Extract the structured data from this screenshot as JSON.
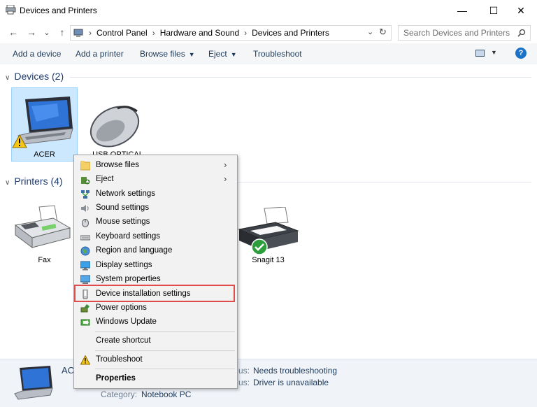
{
  "window": {
    "title": "Devices and Printers",
    "controls": {
      "minimize": "—",
      "maximize": "☐",
      "close": "✕"
    }
  },
  "nav": {
    "back": "←",
    "forward": "→",
    "recent": "⌄",
    "up": "↑",
    "breadcrumb": [
      "Control Panel",
      "Hardware and Sound",
      "Devices and Printers"
    ],
    "search_placeholder": "Search Devices and Printers"
  },
  "toolbar": {
    "add_device": "Add a device",
    "add_printer": "Add a printer",
    "browse_files": "Browse files",
    "eject": "Eject",
    "troubleshoot": "Troubleshoot",
    "help": "?"
  },
  "groups": {
    "devices": {
      "label": "Devices (2)"
    },
    "printers": {
      "label": "Printers (4)"
    }
  },
  "devices": [
    {
      "name": "ACER",
      "icon": "laptop-icon",
      "warning": true
    },
    {
      "name": "USB OPTICAL",
      "icon": "mouse-icon"
    }
  ],
  "printers": [
    {
      "name": "Fax",
      "icon": "fax-icon"
    },
    {
      "name": "Snagit 13",
      "icon": "printer-icon",
      "default": true
    }
  ],
  "context_menu": {
    "items": [
      {
        "label": "Browse files",
        "icon": "folder-icon",
        "submenu": true
      },
      {
        "label": "Eject",
        "icon": "eject-icon",
        "submenu": true
      },
      {
        "label": "Network settings",
        "icon": "network-icon"
      },
      {
        "label": "Sound settings",
        "icon": "speaker-icon"
      },
      {
        "label": "Mouse settings",
        "icon": "mouse-icon"
      },
      {
        "label": "Keyboard settings",
        "icon": "keyboard-icon"
      },
      {
        "label": "Region and language",
        "icon": "globe-icon"
      },
      {
        "label": "Display settings",
        "icon": "monitor-icon"
      },
      {
        "label": "System properties",
        "icon": "computer-icon"
      },
      {
        "label": "Device installation settings",
        "icon": "device-install-icon",
        "highlighted": true
      },
      {
        "label": "Power options",
        "icon": "power-icon"
      },
      {
        "label": "Windows Update",
        "icon": "windows-update-icon"
      },
      {
        "label": "Create shortcut"
      },
      {
        "label": "Troubleshoot",
        "icon": "warning-icon"
      },
      {
        "label": "Properties",
        "bold": true
      }
    ]
  },
  "details": {
    "name_partial": "AC",
    "status_label_partial": "us:",
    "status_value": "Needs troubleshooting",
    "driver_label_partial": "us:",
    "driver_value": "Driver is unavailable",
    "category_label": "Category:",
    "category_value": "Notebook PC"
  },
  "colors": {
    "selection": "#cce8ff",
    "highlight_outline": "#e04b4b",
    "group_heading": "#1e3a6e"
  }
}
